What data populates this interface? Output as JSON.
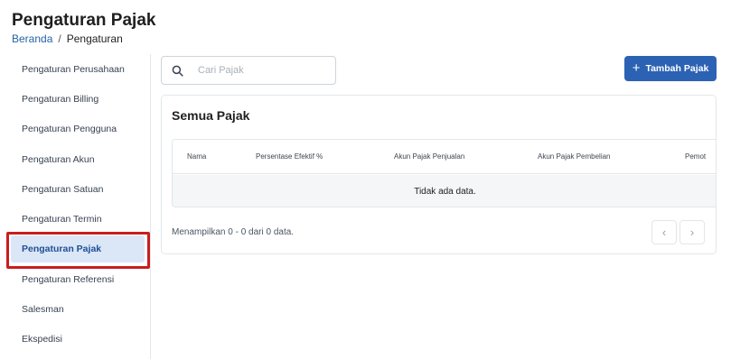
{
  "header": {
    "title": "Pengaturan Pajak",
    "breadcrumb": {
      "home": "Beranda",
      "separator": "/",
      "current": "Pengaturan"
    }
  },
  "sidebar": {
    "items": [
      {
        "label": "Pengaturan Perusahaan"
      },
      {
        "label": "Pengaturan Billing"
      },
      {
        "label": "Pengaturan Pengguna"
      },
      {
        "label": "Pengaturan Akun"
      },
      {
        "label": "Pengaturan Satuan"
      },
      {
        "label": "Pengaturan Termin"
      },
      {
        "label": "Pengaturan Pajak",
        "active": true
      },
      {
        "label": "Pengaturan Referensi"
      },
      {
        "label": "Salesman"
      },
      {
        "label": "Ekspedisi"
      }
    ]
  },
  "search": {
    "placeholder": "Cari Pajak",
    "value": "",
    "icon": "search-icon"
  },
  "add_button": {
    "icon": "plus-icon",
    "label": "Tambah Pajak"
  },
  "table": {
    "title": "Semua Pajak",
    "columns": [
      "Nama",
      "Persentase Efektif %",
      "Akun Pajak Penjualan",
      "Akun Pajak Pembelian",
      "Pemot"
    ],
    "empty_text": "Tidak ada data.",
    "footer": "Menampilkan 0 - 0 dari 0 data."
  },
  "pagination": {
    "prev_icon": "chevron-left-icon",
    "prev": "‹",
    "next_icon": "chevron-right-icon",
    "next": "›"
  },
  "colors": {
    "primary": "#2c62b3",
    "link": "#2563a6",
    "active_bg": "#dbe6f7",
    "highlight": "#c81e1e"
  }
}
